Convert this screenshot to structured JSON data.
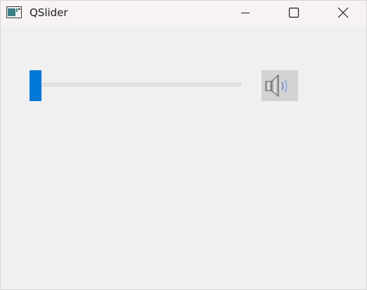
{
  "window": {
    "title": "QSlider"
  },
  "slider": {
    "value_fraction": 0.0,
    "accent_color": "#0078d7",
    "orientation": "horizontal"
  },
  "volume_button": {
    "icon": "speaker-volume-icon"
  }
}
